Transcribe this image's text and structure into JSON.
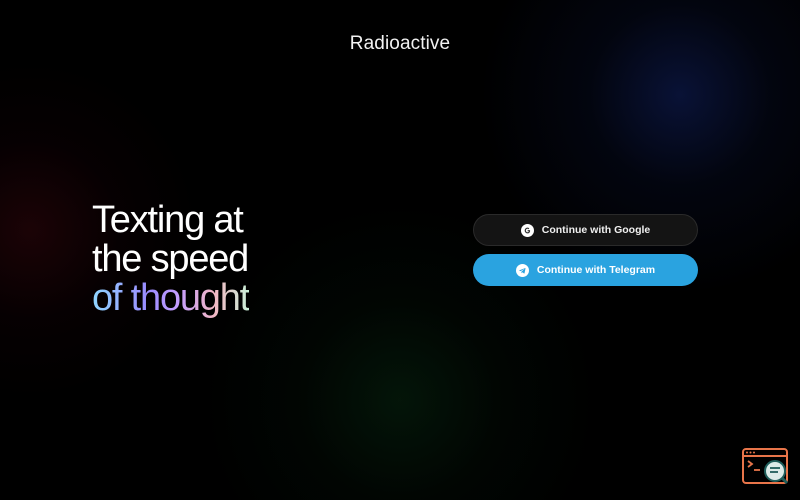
{
  "app": {
    "brand_name": "Radioactive"
  },
  "hero": {
    "line1": "Texting at",
    "line2": "the speed",
    "line3": "of thought"
  },
  "auth": {
    "google_label": "Continue with Google",
    "telegram_label": "Continue with Telegram"
  },
  "icons": {
    "google": "google-icon",
    "telegram": "telegram-icon",
    "widget": "terminal-search-icon"
  },
  "colors": {
    "background": "#000000",
    "telegram_button": "#2aa3e0",
    "google_button": "#141414",
    "widget_accent": "#e8754a"
  }
}
